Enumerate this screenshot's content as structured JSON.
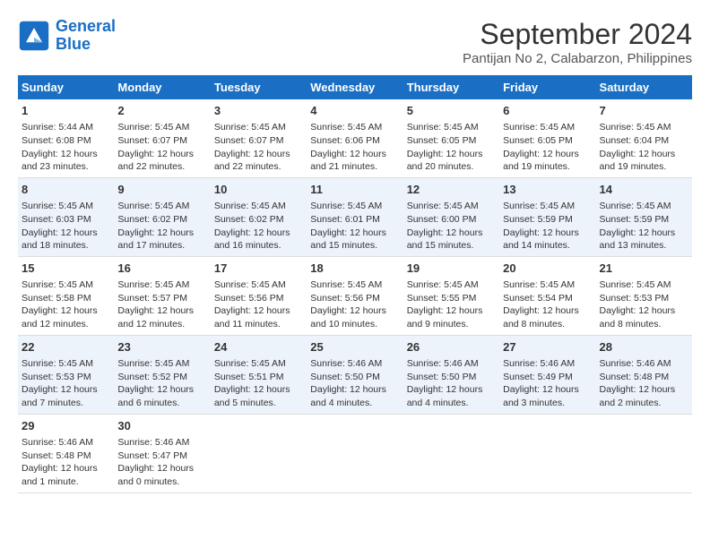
{
  "logo": {
    "line1": "General",
    "line2": "Blue"
  },
  "title": "September 2024",
  "location": "Pantijan No 2, Calabarzon, Philippines",
  "headers": [
    "Sunday",
    "Monday",
    "Tuesday",
    "Wednesday",
    "Thursday",
    "Friday",
    "Saturday"
  ],
  "weeks": [
    [
      {
        "day": "1",
        "sunrise": "Sunrise: 5:44 AM",
        "sunset": "Sunset: 6:08 PM",
        "daylight": "Daylight: 12 hours and 23 minutes."
      },
      {
        "day": "2",
        "sunrise": "Sunrise: 5:45 AM",
        "sunset": "Sunset: 6:07 PM",
        "daylight": "Daylight: 12 hours and 22 minutes."
      },
      {
        "day": "3",
        "sunrise": "Sunrise: 5:45 AM",
        "sunset": "Sunset: 6:07 PM",
        "daylight": "Daylight: 12 hours and 22 minutes."
      },
      {
        "day": "4",
        "sunrise": "Sunrise: 5:45 AM",
        "sunset": "Sunset: 6:06 PM",
        "daylight": "Daylight: 12 hours and 21 minutes."
      },
      {
        "day": "5",
        "sunrise": "Sunrise: 5:45 AM",
        "sunset": "Sunset: 6:05 PM",
        "daylight": "Daylight: 12 hours and 20 minutes."
      },
      {
        "day": "6",
        "sunrise": "Sunrise: 5:45 AM",
        "sunset": "Sunset: 6:05 PM",
        "daylight": "Daylight: 12 hours and 19 minutes."
      },
      {
        "day": "7",
        "sunrise": "Sunrise: 5:45 AM",
        "sunset": "Sunset: 6:04 PM",
        "daylight": "Daylight: 12 hours and 19 minutes."
      }
    ],
    [
      {
        "day": "8",
        "sunrise": "Sunrise: 5:45 AM",
        "sunset": "Sunset: 6:03 PM",
        "daylight": "Daylight: 12 hours and 18 minutes."
      },
      {
        "day": "9",
        "sunrise": "Sunrise: 5:45 AM",
        "sunset": "Sunset: 6:02 PM",
        "daylight": "Daylight: 12 hours and 17 minutes."
      },
      {
        "day": "10",
        "sunrise": "Sunrise: 5:45 AM",
        "sunset": "Sunset: 6:02 PM",
        "daylight": "Daylight: 12 hours and 16 minutes."
      },
      {
        "day": "11",
        "sunrise": "Sunrise: 5:45 AM",
        "sunset": "Sunset: 6:01 PM",
        "daylight": "Daylight: 12 hours and 15 minutes."
      },
      {
        "day": "12",
        "sunrise": "Sunrise: 5:45 AM",
        "sunset": "Sunset: 6:00 PM",
        "daylight": "Daylight: 12 hours and 15 minutes."
      },
      {
        "day": "13",
        "sunrise": "Sunrise: 5:45 AM",
        "sunset": "Sunset: 5:59 PM",
        "daylight": "Daylight: 12 hours and 14 minutes."
      },
      {
        "day": "14",
        "sunrise": "Sunrise: 5:45 AM",
        "sunset": "Sunset: 5:59 PM",
        "daylight": "Daylight: 12 hours and 13 minutes."
      }
    ],
    [
      {
        "day": "15",
        "sunrise": "Sunrise: 5:45 AM",
        "sunset": "Sunset: 5:58 PM",
        "daylight": "Daylight: 12 hours and 12 minutes."
      },
      {
        "day": "16",
        "sunrise": "Sunrise: 5:45 AM",
        "sunset": "Sunset: 5:57 PM",
        "daylight": "Daylight: 12 hours and 12 minutes."
      },
      {
        "day": "17",
        "sunrise": "Sunrise: 5:45 AM",
        "sunset": "Sunset: 5:56 PM",
        "daylight": "Daylight: 12 hours and 11 minutes."
      },
      {
        "day": "18",
        "sunrise": "Sunrise: 5:45 AM",
        "sunset": "Sunset: 5:56 PM",
        "daylight": "Daylight: 12 hours and 10 minutes."
      },
      {
        "day": "19",
        "sunrise": "Sunrise: 5:45 AM",
        "sunset": "Sunset: 5:55 PM",
        "daylight": "Daylight: 12 hours and 9 minutes."
      },
      {
        "day": "20",
        "sunrise": "Sunrise: 5:45 AM",
        "sunset": "Sunset: 5:54 PM",
        "daylight": "Daylight: 12 hours and 8 minutes."
      },
      {
        "day": "21",
        "sunrise": "Sunrise: 5:45 AM",
        "sunset": "Sunset: 5:53 PM",
        "daylight": "Daylight: 12 hours and 8 minutes."
      }
    ],
    [
      {
        "day": "22",
        "sunrise": "Sunrise: 5:45 AM",
        "sunset": "Sunset: 5:53 PM",
        "daylight": "Daylight: 12 hours and 7 minutes."
      },
      {
        "day": "23",
        "sunrise": "Sunrise: 5:45 AM",
        "sunset": "Sunset: 5:52 PM",
        "daylight": "Daylight: 12 hours and 6 minutes."
      },
      {
        "day": "24",
        "sunrise": "Sunrise: 5:45 AM",
        "sunset": "Sunset: 5:51 PM",
        "daylight": "Daylight: 12 hours and 5 minutes."
      },
      {
        "day": "25",
        "sunrise": "Sunrise: 5:46 AM",
        "sunset": "Sunset: 5:50 PM",
        "daylight": "Daylight: 12 hours and 4 minutes."
      },
      {
        "day": "26",
        "sunrise": "Sunrise: 5:46 AM",
        "sunset": "Sunset: 5:50 PM",
        "daylight": "Daylight: 12 hours and 4 minutes."
      },
      {
        "day": "27",
        "sunrise": "Sunrise: 5:46 AM",
        "sunset": "Sunset: 5:49 PM",
        "daylight": "Daylight: 12 hours and 3 minutes."
      },
      {
        "day": "28",
        "sunrise": "Sunrise: 5:46 AM",
        "sunset": "Sunset: 5:48 PM",
        "daylight": "Daylight: 12 hours and 2 minutes."
      }
    ],
    [
      {
        "day": "29",
        "sunrise": "Sunrise: 5:46 AM",
        "sunset": "Sunset: 5:48 PM",
        "daylight": "Daylight: 12 hours and 1 minute."
      },
      {
        "day": "30",
        "sunrise": "Sunrise: 5:46 AM",
        "sunset": "Sunset: 5:47 PM",
        "daylight": "Daylight: 12 hours and 0 minutes."
      },
      {
        "day": "",
        "sunrise": "",
        "sunset": "",
        "daylight": ""
      },
      {
        "day": "",
        "sunrise": "",
        "sunset": "",
        "daylight": ""
      },
      {
        "day": "",
        "sunrise": "",
        "sunset": "",
        "daylight": ""
      },
      {
        "day": "",
        "sunrise": "",
        "sunset": "",
        "daylight": ""
      },
      {
        "day": "",
        "sunrise": "",
        "sunset": "",
        "daylight": ""
      }
    ]
  ]
}
